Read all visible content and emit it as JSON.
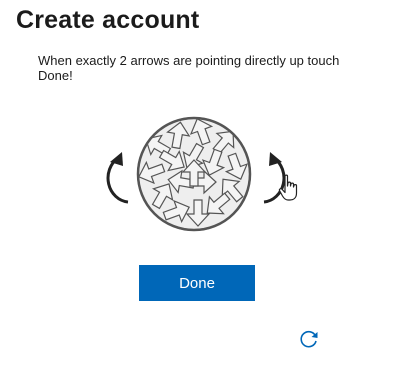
{
  "page": {
    "title": "Create account",
    "instructions": "When exactly 2 arrows are pointing directly up touch Done!"
  },
  "puzzle": {
    "rotate_left_icon": "rotate-counterclockwise-icon",
    "rotate_right_icon": "rotate-clockwise-icon",
    "image_icon": "arrow-circle-puzzle-image"
  },
  "actions": {
    "done_label": "Done",
    "refresh_icon": "refresh-icon"
  },
  "colors": {
    "primary": "#0067b8",
    "text": "#1b1b1b",
    "icon_stroke": "#222222"
  }
}
